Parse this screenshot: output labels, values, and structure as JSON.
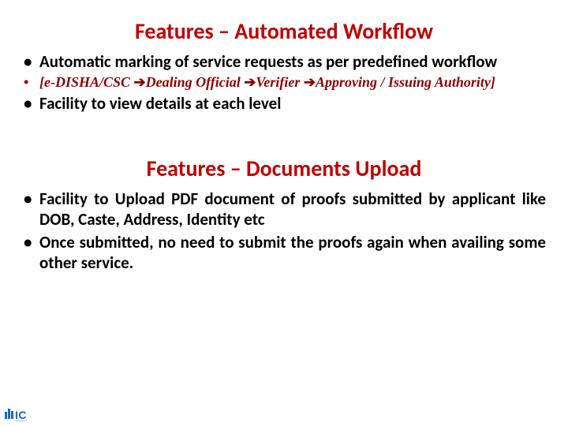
{
  "section1": {
    "title": "Features – Automated Workflow",
    "bullets": [
      "Automatic marking of service requests as per predefined workflow",
      null,
      "Facility to view details at each level"
    ],
    "flow": {
      "open": "[",
      "close": "]",
      "s1": "e-DISHA/CSC ",
      "s2": "Dealing Official ",
      "s3": "Verifier ",
      "s4": "Approving / Issuing Authority",
      "arrow": "➔"
    }
  },
  "section2": {
    "title": "Features – Documents Upload",
    "bullets": [
      "Facility to Upload PDF document of proofs submitted by applicant like DOB, Caste, Address, Identity etc",
      "Once submitted, no need to submit the proofs again when availing some other service."
    ]
  },
  "logo": {
    "text": "IC"
  }
}
